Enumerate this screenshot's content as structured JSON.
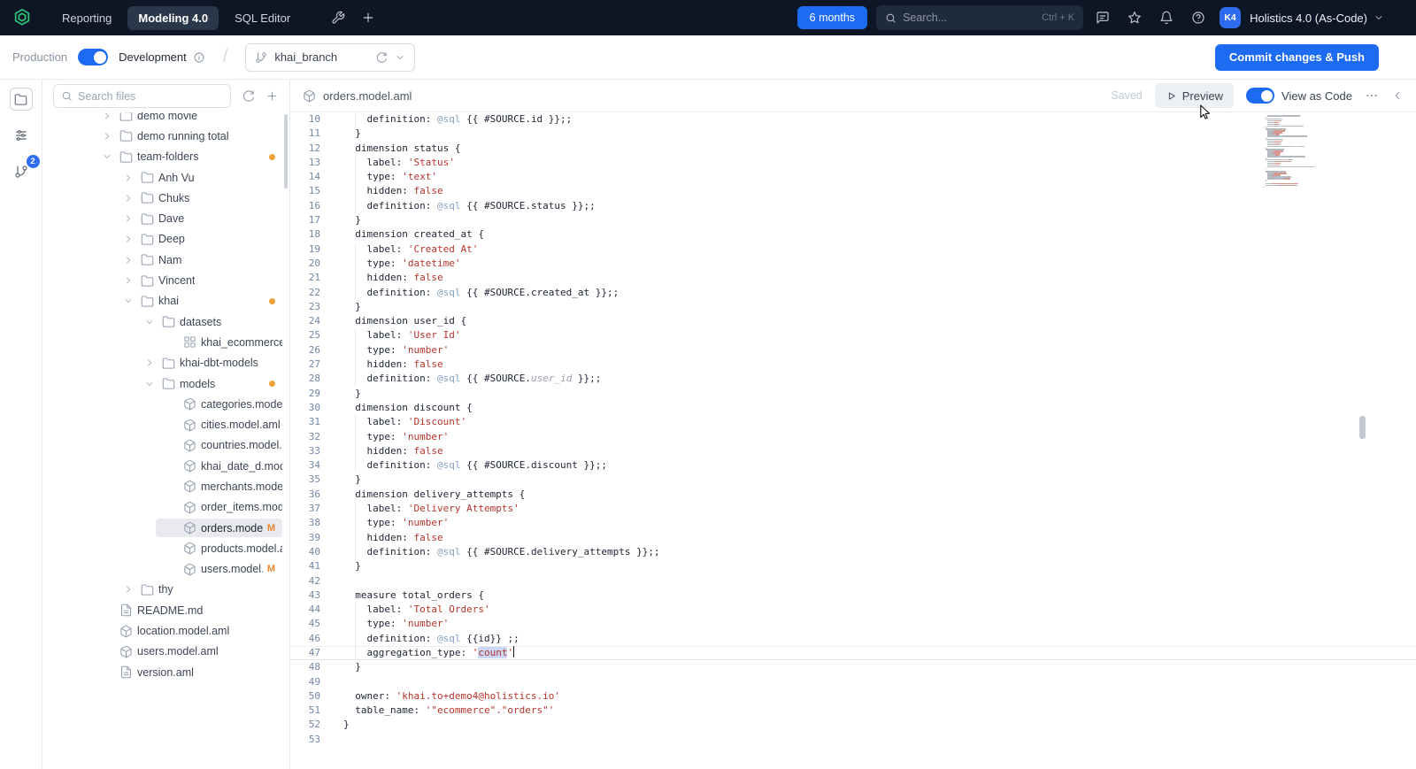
{
  "topnav": {
    "tabs": [
      {
        "label": "Reporting"
      },
      {
        "label": "Modeling 4.0",
        "active": true
      },
      {
        "label": "SQL Editor"
      }
    ],
    "time_range_label": "6 months",
    "search": {
      "placeholder": "Search...",
      "shortcut": "Ctrl + K"
    },
    "avatar_initials": "K4",
    "workspace_label": "Holistics 4.0 (As-Code)"
  },
  "toolbar": {
    "production_label": "Production",
    "development_label": "Development",
    "branch_name": "khai_branch",
    "commit_button_label": "Commit changes & Push"
  },
  "rail": {
    "git_badge_count": "2"
  },
  "sidebar": {
    "search_placeholder": "Search files",
    "tree": [
      {
        "label": "demo movie",
        "icon": "folder-icon",
        "level": 0,
        "chev": "right"
      },
      {
        "label": "demo running total",
        "icon": "folder-icon",
        "level": 0,
        "chev": "right"
      },
      {
        "label": "team-folders",
        "icon": "folder-icon",
        "level": 0,
        "chev": "down",
        "dot": true
      },
      {
        "label": "Anh Vu",
        "icon": "folder-icon",
        "level": 1,
        "chev": "right"
      },
      {
        "label": "Chuks",
        "icon": "folder-icon",
        "level": 1,
        "chev": "right"
      },
      {
        "label": "Dave",
        "icon": "folder-icon",
        "level": 1,
        "chev": "right"
      },
      {
        "label": "Deep",
        "icon": "folder-icon",
        "level": 1,
        "chev": "right"
      },
      {
        "label": "Nam",
        "icon": "folder-icon",
        "level": 1,
        "chev": "right"
      },
      {
        "label": "Vincent",
        "icon": "folder-icon",
        "level": 1,
        "chev": "right"
      },
      {
        "label": "khai",
        "icon": "folder-icon",
        "level": 1,
        "chev": "down",
        "dot": true
      },
      {
        "label": "datasets",
        "icon": "folder-icon",
        "level": 2,
        "chev": "down"
      },
      {
        "label": "khai_ecommerce.d...",
        "icon": "dataset-icon",
        "level": 3
      },
      {
        "label": "khai-dbt-models",
        "icon": "folder-icon",
        "level": 2,
        "chev": "right"
      },
      {
        "label": "models",
        "icon": "folder-icon",
        "level": 2,
        "chev": "down",
        "dot": true
      },
      {
        "label": "categories.model.aml",
        "icon": "model-icon",
        "level": 3
      },
      {
        "label": "cities.model.aml",
        "icon": "model-icon",
        "level": 3
      },
      {
        "label": "countries.model.aml",
        "icon": "model-icon",
        "level": 3
      },
      {
        "label": "khai_date_d.model....",
        "icon": "model-icon",
        "level": 3
      },
      {
        "label": "merchants.model.aml",
        "icon": "model-icon",
        "level": 3
      },
      {
        "label": "order_items.model...",
        "icon": "model-icon",
        "level": 3
      },
      {
        "label": "orders.model.aml",
        "icon": "model-icon",
        "level": 3,
        "selected": true,
        "badge": "M"
      },
      {
        "label": "products.model.aml",
        "icon": "model-icon",
        "level": 3
      },
      {
        "label": "users.model.aml",
        "icon": "model-icon",
        "level": 3,
        "badge": "M"
      },
      {
        "label": "thy",
        "icon": "folder-icon",
        "level": 1,
        "chev": "right"
      },
      {
        "label": "README.md",
        "icon": "doc-icon",
        "level": 0
      },
      {
        "label": "location.model.aml",
        "icon": "model-icon",
        "level": 0
      },
      {
        "label": "users.model.aml",
        "icon": "model-icon",
        "level": 0
      },
      {
        "label": "version.aml",
        "icon": "doc-icon",
        "level": 0
      }
    ]
  },
  "editor": {
    "filename": "orders.model.aml",
    "status_label": "Saved",
    "preview_button_label": "Preview",
    "view_toggle_label": "View as Code",
    "lines": [
      {
        "n": 10,
        "g": true,
        "s": [
          [
            "p",
            "    definition: "
          ],
          [
            "q",
            "@sql"
          ],
          [
            "p",
            " {{ #SOURCE.id }};;"
          ]
        ]
      },
      {
        "n": 11,
        "s": [
          [
            "p",
            "  }"
          ]
        ]
      },
      {
        "n": 12,
        "s": [
          [
            "p",
            "  dimension status {"
          ]
        ]
      },
      {
        "n": 13,
        "g": true,
        "s": [
          [
            "p",
            "    label: "
          ],
          [
            "s",
            "'Status'"
          ]
        ]
      },
      {
        "n": 14,
        "g": true,
        "s": [
          [
            "p",
            "    type: "
          ],
          [
            "s",
            "'text'"
          ]
        ]
      },
      {
        "n": 15,
        "g": true,
        "s": [
          [
            "p",
            "    hidden: "
          ],
          [
            "k",
            "false"
          ]
        ]
      },
      {
        "n": 16,
        "g": true,
        "s": [
          [
            "p",
            "    definition: "
          ],
          [
            "q",
            "@sql"
          ],
          [
            "p",
            " {{ #SOURCE.status }};;"
          ]
        ]
      },
      {
        "n": 17,
        "s": [
          [
            "p",
            "  }"
          ]
        ]
      },
      {
        "n": 18,
        "s": [
          [
            "p",
            "  dimension created_at {"
          ]
        ]
      },
      {
        "n": 19,
        "g": true,
        "s": [
          [
            "p",
            "    label: "
          ],
          [
            "s",
            "'Created At'"
          ]
        ]
      },
      {
        "n": 20,
        "g": true,
        "s": [
          [
            "p",
            "    type: "
          ],
          [
            "s",
            "'datetime'"
          ]
        ]
      },
      {
        "n": 21,
        "g": true,
        "s": [
          [
            "p",
            "    hidden: "
          ],
          [
            "k",
            "false"
          ]
        ]
      },
      {
        "n": 22,
        "g": true,
        "s": [
          [
            "p",
            "    definition: "
          ],
          [
            "q",
            "@sql"
          ],
          [
            "p",
            " {{ #SOURCE.created_at }};;"
          ]
        ]
      },
      {
        "n": 23,
        "s": [
          [
            "p",
            "  }"
          ]
        ]
      },
      {
        "n": 24,
        "s": [
          [
            "p",
            "  dimension user_id {"
          ]
        ]
      },
      {
        "n": 25,
        "g": true,
        "s": [
          [
            "p",
            "    label: "
          ],
          [
            "s",
            "'User Id'"
          ]
        ]
      },
      {
        "n": 26,
        "g": true,
        "s": [
          [
            "p",
            "    type: "
          ],
          [
            "s",
            "'number'"
          ]
        ]
      },
      {
        "n": 27,
        "g": true,
        "s": [
          [
            "p",
            "    hidden: "
          ],
          [
            "k",
            "false"
          ]
        ]
      },
      {
        "n": 28,
        "g": true,
        "s": [
          [
            "p",
            "    definition: "
          ],
          [
            "q",
            "@sql"
          ],
          [
            "p",
            " {{ #SOURCE."
          ],
          [
            "i",
            "user_id"
          ],
          [
            "p",
            " }};;"
          ]
        ]
      },
      {
        "n": 29,
        "s": [
          [
            "p",
            "  }"
          ]
        ]
      },
      {
        "n": 30,
        "s": [
          [
            "p",
            "  dimension discount {"
          ]
        ]
      },
      {
        "n": 31,
        "g": true,
        "s": [
          [
            "p",
            "    label: "
          ],
          [
            "s",
            "'Discount'"
          ]
        ]
      },
      {
        "n": 32,
        "g": true,
        "s": [
          [
            "p",
            "    type: "
          ],
          [
            "s",
            "'number'"
          ]
        ]
      },
      {
        "n": 33,
        "g": true,
        "s": [
          [
            "p",
            "    hidden: "
          ],
          [
            "k",
            "false"
          ]
        ]
      },
      {
        "n": 34,
        "g": true,
        "s": [
          [
            "p",
            "    definition: "
          ],
          [
            "q",
            "@sql"
          ],
          [
            "p",
            " {{ #SOURCE.discount }};;"
          ]
        ]
      },
      {
        "n": 35,
        "s": [
          [
            "p",
            "  }"
          ]
        ]
      },
      {
        "n": 36,
        "s": [
          [
            "p",
            "  dimension delivery_attempts {"
          ]
        ]
      },
      {
        "n": 37,
        "g": true,
        "s": [
          [
            "p",
            "    label: "
          ],
          [
            "s",
            "'Delivery Attempts'"
          ]
        ]
      },
      {
        "n": 38,
        "g": true,
        "s": [
          [
            "p",
            "    type: "
          ],
          [
            "s",
            "'number'"
          ]
        ]
      },
      {
        "n": 39,
        "g": true,
        "s": [
          [
            "p",
            "    hidden: "
          ],
          [
            "k",
            "false"
          ]
        ]
      },
      {
        "n": 40,
        "g": true,
        "s": [
          [
            "p",
            "    definition: "
          ],
          [
            "q",
            "@sql"
          ],
          [
            "p",
            " {{ #SOURCE.delivery_attempts }};;"
          ]
        ]
      },
      {
        "n": 41,
        "s": [
          [
            "p",
            "  }"
          ]
        ]
      },
      {
        "n": 42,
        "s": []
      },
      {
        "n": 43,
        "s": [
          [
            "p",
            "  measure total_orders {"
          ]
        ]
      },
      {
        "n": 44,
        "g": true,
        "s": [
          [
            "p",
            "    label: "
          ],
          [
            "s",
            "'Total Orders'"
          ]
        ]
      },
      {
        "n": 45,
        "g": true,
        "s": [
          [
            "p",
            "    type: "
          ],
          [
            "s",
            "'number'"
          ]
        ]
      },
      {
        "n": 46,
        "g": true,
        "s": [
          [
            "p",
            "    definition: "
          ],
          [
            "q",
            "@sql"
          ],
          [
            "p",
            " {{id}} ;;"
          ]
        ]
      },
      {
        "n": 47,
        "g": true,
        "cur": true,
        "s": [
          [
            "p",
            "    aggregation_type: "
          ],
          [
            "s",
            "'"
          ],
          [
            "hl",
            "count"
          ],
          [
            "s",
            "'"
          ],
          [
            "caret",
            ""
          ]
        ]
      },
      {
        "n": 48,
        "s": [
          [
            "p",
            "  }"
          ]
        ]
      },
      {
        "n": 49,
        "s": []
      },
      {
        "n": 50,
        "s": [
          [
            "p",
            "  owner: "
          ],
          [
            "s",
            "'khai.to+demo4@holistics.io'"
          ]
        ]
      },
      {
        "n": 51,
        "s": [
          [
            "p",
            "  table_name: "
          ],
          [
            "s",
            "'\"ecommerce\".\"orders\"'"
          ]
        ]
      },
      {
        "n": 52,
        "s": [
          [
            "p",
            "}"
          ]
        ]
      },
      {
        "n": 53,
        "s": []
      }
    ]
  },
  "colors": {
    "accent_blue": "#1d6bf3",
    "modified_orange": "#e8872e",
    "modified_dot": "#f0a23a",
    "syntax_string_red": "#b7342b",
    "syntax_atsql_blue": "#86a3c3",
    "selection_highlight": "#c9d7f5",
    "navbar_dark": "#0d1624"
  }
}
